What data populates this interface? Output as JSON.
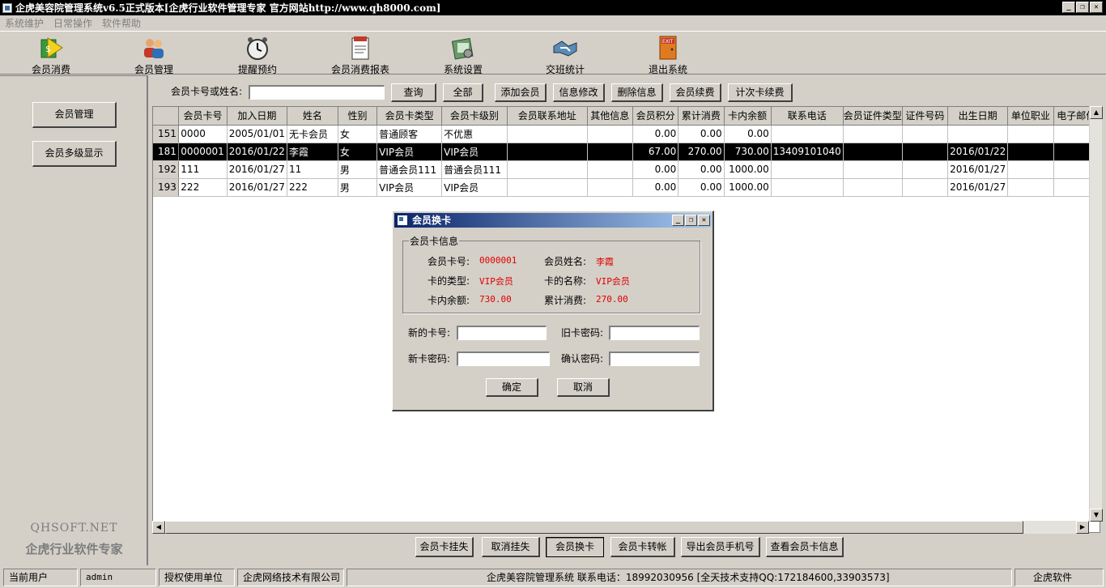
{
  "window": {
    "title": "企虎美容院管理系统v6.5正式版本[企虎行业软件管理专家 官方网站http://www.qh8000.com]",
    "minimize": "_",
    "restore": "❐",
    "close": "✕"
  },
  "menu": [
    "系统维护",
    "日常操作",
    "软件帮助"
  ],
  "toolbar": [
    {
      "label": "会员消费",
      "icon": "money-arrow-icon"
    },
    {
      "label": "会员管理",
      "icon": "members-icon"
    },
    {
      "label": "提醒预约",
      "icon": "alarm-clock-icon"
    },
    {
      "label": "会员消费报表",
      "icon": "report-icon"
    },
    {
      "label": "系统设置",
      "icon": "settings-icon"
    },
    {
      "label": "交班统计",
      "icon": "handshake-icon"
    },
    {
      "label": "退出系统",
      "icon": "exit-door-icon"
    }
  ],
  "left_panel": {
    "buttons": [
      "会员管理",
      "会员多级显示"
    ],
    "brand_en": "QHSOFT.NET",
    "brand_cn": "企虎行业软件专家"
  },
  "search": {
    "label": "会员卡号或姓名:",
    "value": "",
    "buttons": [
      "查询",
      "全部",
      "添加会员",
      "信息修改",
      "删除信息",
      "会员续费",
      "计次卡续费"
    ]
  },
  "grid": {
    "columns": [
      "会员卡号",
      "加入日期",
      "姓名",
      "性别",
      "会员卡类型",
      "会员卡级别",
      "会员联系地址",
      "其他信息",
      "会员积分",
      "累计消费",
      "卡内余额",
      "联系电话",
      "会员证件类型",
      "证件号码",
      "出生日期",
      "单位职业",
      "电子邮件"
    ],
    "rows": [
      {
        "id": "151",
        "cells": [
          "0000",
          "2005/01/01",
          "无卡会员",
          "女",
          "普通顾客",
          "不优惠",
          "",
          "",
          "0.00",
          "0.00",
          "0.00",
          "",
          "",
          "",
          "",
          "",
          ""
        ]
      },
      {
        "id": "181",
        "cells": [
          "0000001",
          "2016/01/22",
          "李霞",
          "女",
          "VIP会员",
          "VIP会员",
          "",
          "",
          "67.00",
          "270.00",
          "730.00",
          "13409101040",
          "",
          "",
          "2016/01/22",
          "",
          ""
        ],
        "selected": true
      },
      {
        "id": "192",
        "cells": [
          "111",
          "2016/01/27",
          "11",
          "男",
          "普通会员111",
          "普通会员111",
          "",
          "",
          "0.00",
          "0.00",
          "1000.00",
          "",
          "",
          "",
          "2016/01/27",
          "",
          ""
        ]
      },
      {
        "id": "193",
        "cells": [
          "222",
          "2016/01/27",
          "222",
          "男",
          "VIP会员",
          "VIP会员",
          "",
          "",
          "0.00",
          "0.00",
          "1000.00",
          "",
          "",
          "",
          "2016/01/27",
          "",
          ""
        ]
      }
    ]
  },
  "bottom_buttons": [
    "会员卡挂失",
    "取消挂失",
    "会员换卡",
    "会员卡转帐",
    "导出会员手机号",
    "查看会员卡信息"
  ],
  "status": {
    "current_user_label": "当前用户",
    "current_user": "admin",
    "license_label": "授权使用单位",
    "license_company": "企虎网络技术有限公司",
    "info": "企虎美容院管理系统    联系电话：18992030956   [全天技术支持QQ:172184600,33903573]",
    "brand": "企虎软件"
  },
  "dialog": {
    "title": "会员换卡",
    "group_title": "会员卡信息",
    "card_no_label": "会员卡号:",
    "card_no": "0000001",
    "name_label": "会员姓名:",
    "name": "李霞",
    "card_type_label": "卡的类型:",
    "card_type": "VIP会员",
    "card_name_label": "卡的名称:",
    "card_name": "VIP会员",
    "balance_label": "卡内余额:",
    "balance": "730.00",
    "total_label": "累计消费:",
    "total": "270.00",
    "new_card_label": "新的卡号:",
    "old_pwd_label": "旧卡密码:",
    "new_pwd_label": "新卡密码:",
    "confirm_pwd_label": "确认密码:",
    "ok": "确定",
    "cancel": "取消"
  },
  "colors": {
    "accent_red": "#e00000",
    "title_gradient_start": "#0a246a",
    "title_gradient_end": "#a6caf0",
    "window_bg": "#d4d0c8"
  }
}
